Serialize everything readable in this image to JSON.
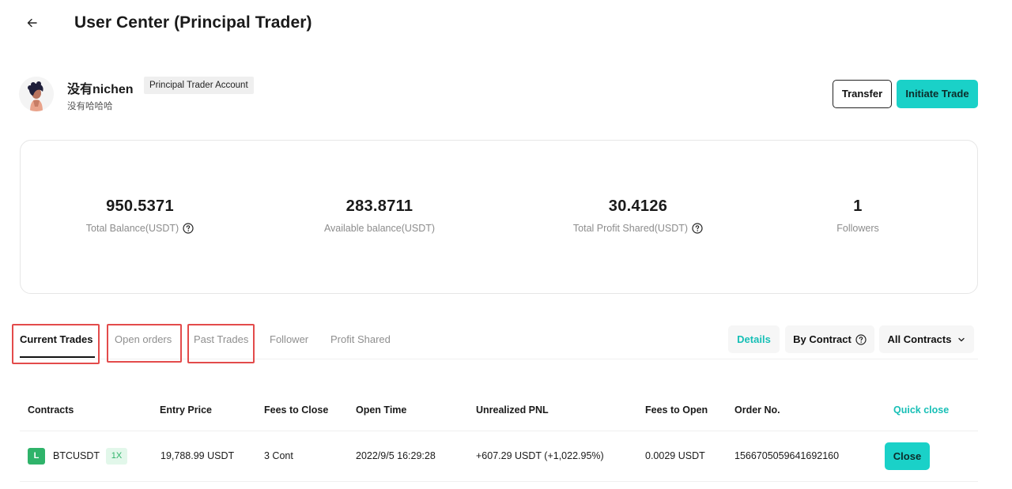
{
  "header": {
    "back_icon": "arrow-left-icon",
    "title": "User Center (Principal Trader)"
  },
  "profile": {
    "avatar_icon": "user-avatar-illustration",
    "username": "没有nichen",
    "account_badge": "Principal Trader Account",
    "sub_name": "没有哈哈哈",
    "transfer_label": "Transfer",
    "initiate_label": "Initiate Trade"
  },
  "stats": [
    {
      "value": "950.5371",
      "label": "Total Balance(USDT)",
      "help": true
    },
    {
      "value": "283.8711",
      "label": "Available balance(USDT)",
      "help": false
    },
    {
      "value": "30.4126",
      "label": "Total Profit Shared(USDT)",
      "help": true
    },
    {
      "value": "1",
      "label": "Followers",
      "help": false
    }
  ],
  "tabs": [
    {
      "label": "Current Trades",
      "active": true
    },
    {
      "label": "Open orders",
      "active": false
    },
    {
      "label": "Past Trades",
      "active": false
    },
    {
      "label": "Follower",
      "active": false
    },
    {
      "label": "Profit Shared",
      "active": false
    }
  ],
  "toolbar": {
    "details_label": "Details",
    "by_contract_label": "By Contract",
    "all_contracts_label": "All Contracts"
  },
  "table": {
    "headers": {
      "contracts": "Contracts",
      "entry_price": "Entry Price",
      "fees_to_close": "Fees to Close",
      "open_time": "Open Time",
      "unrealized_pnl": "Unrealized PNL",
      "fees_to_open": "Fees to Open",
      "order_no": "Order No.",
      "quick_close": "Quick close"
    },
    "rows": [
      {
        "side": "L",
        "symbol": "BTCUSDT",
        "leverage": "1X",
        "entry_price": "19,788.99 USDT",
        "fees_to_close": "3 Cont",
        "open_time": "2022/9/5 16:29:28",
        "unrealized_pnl": "+607.29 USDT (+1,022.95%)",
        "fees_to_open": "0.0029 USDT",
        "order_no": "1566705059641692160",
        "close_label": "Close"
      }
    ]
  },
  "colors": {
    "accent": "#1ad1c8",
    "accent_text": "#17bfb6",
    "long_green": "#2fb36a",
    "highlight_red": "#e34b4b"
  }
}
